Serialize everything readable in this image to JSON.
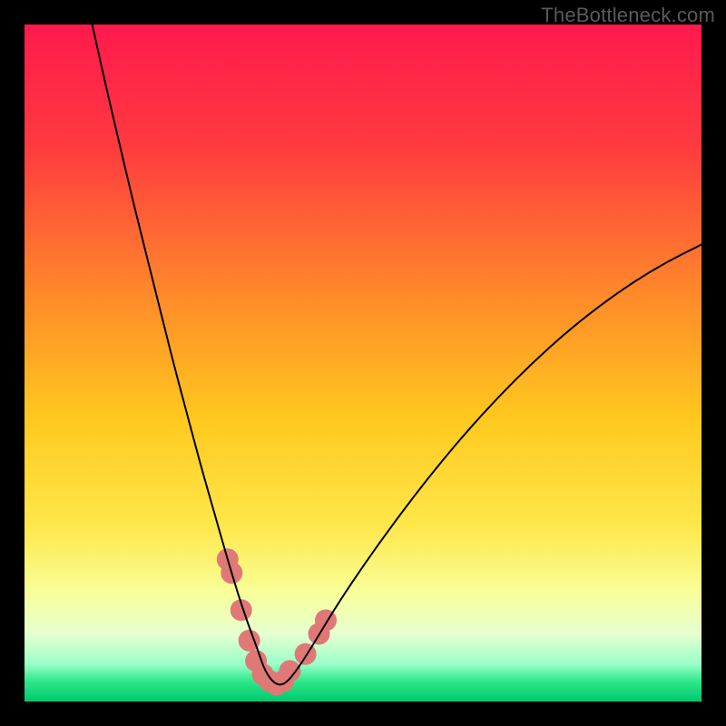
{
  "watermark": "TheBottleneck.com",
  "chart_data": {
    "type": "line",
    "title": "",
    "xlabel": "",
    "ylabel": "",
    "xlim": [
      0,
      100
    ],
    "ylim": [
      0,
      100
    ],
    "gradient_stops": [
      {
        "offset": 0.0,
        "color": "#ff1a4d"
      },
      {
        "offset": 0.18,
        "color": "#ff3a3f"
      },
      {
        "offset": 0.4,
        "color": "#ff8a2a"
      },
      {
        "offset": 0.58,
        "color": "#ffc81e"
      },
      {
        "offset": 0.74,
        "color": "#ffe74a"
      },
      {
        "offset": 0.84,
        "color": "#f8ff9a"
      },
      {
        "offset": 0.9,
        "color": "#e6ffd0"
      },
      {
        "offset": 0.945,
        "color": "#9affc8"
      },
      {
        "offset": 0.97,
        "color": "#2ee88a"
      },
      {
        "offset": 1.0,
        "color": "#00c86e"
      }
    ],
    "series": [
      {
        "name": "bottleneck-curve",
        "x": [
          10.0,
          12.0,
          14.0,
          16.0,
          18.0,
          20.0,
          22.0,
          24.0,
          26.0,
          28.0,
          30.0,
          31.5,
          33.0,
          34.5,
          35.5,
          37.0,
          38.5,
          40.5,
          43.0,
          46.0,
          50.0,
          55.0,
          60.0,
          65.0,
          70.0,
          75.0,
          80.0,
          85.0,
          90.0,
          95.0,
          100.0
        ],
        "y": [
          100.0,
          91.0,
          82.5,
          74.0,
          66.0,
          58.0,
          50.0,
          42.5,
          35.0,
          28.0,
          21.0,
          16.0,
          11.5,
          7.5,
          4.5,
          2.5,
          2.5,
          5.0,
          9.0,
          14.0,
          20.0,
          27.0,
          33.5,
          39.5,
          45.0,
          50.0,
          54.5,
          58.5,
          62.0,
          65.0,
          67.5
        ]
      }
    ],
    "markers": {
      "name": "highlight-band",
      "color": "#e07878",
      "radius_px": 12,
      "points": [
        {
          "x": 30.0,
          "y": 21.0
        },
        {
          "x": 30.6,
          "y": 19.0
        },
        {
          "x": 32.0,
          "y": 13.5
        },
        {
          "x": 33.2,
          "y": 9.0
        },
        {
          "x": 34.2,
          "y": 6.0
        },
        {
          "x": 35.2,
          "y": 4.0
        },
        {
          "x": 36.2,
          "y": 3.0
        },
        {
          "x": 37.2,
          "y": 2.5
        },
        {
          "x": 38.2,
          "y": 3.0
        },
        {
          "x": 39.2,
          "y": 4.5
        },
        {
          "x": 41.5,
          "y": 7.0
        },
        {
          "x": 43.5,
          "y": 10.0
        },
        {
          "x": 44.5,
          "y": 12.0
        }
      ]
    }
  }
}
